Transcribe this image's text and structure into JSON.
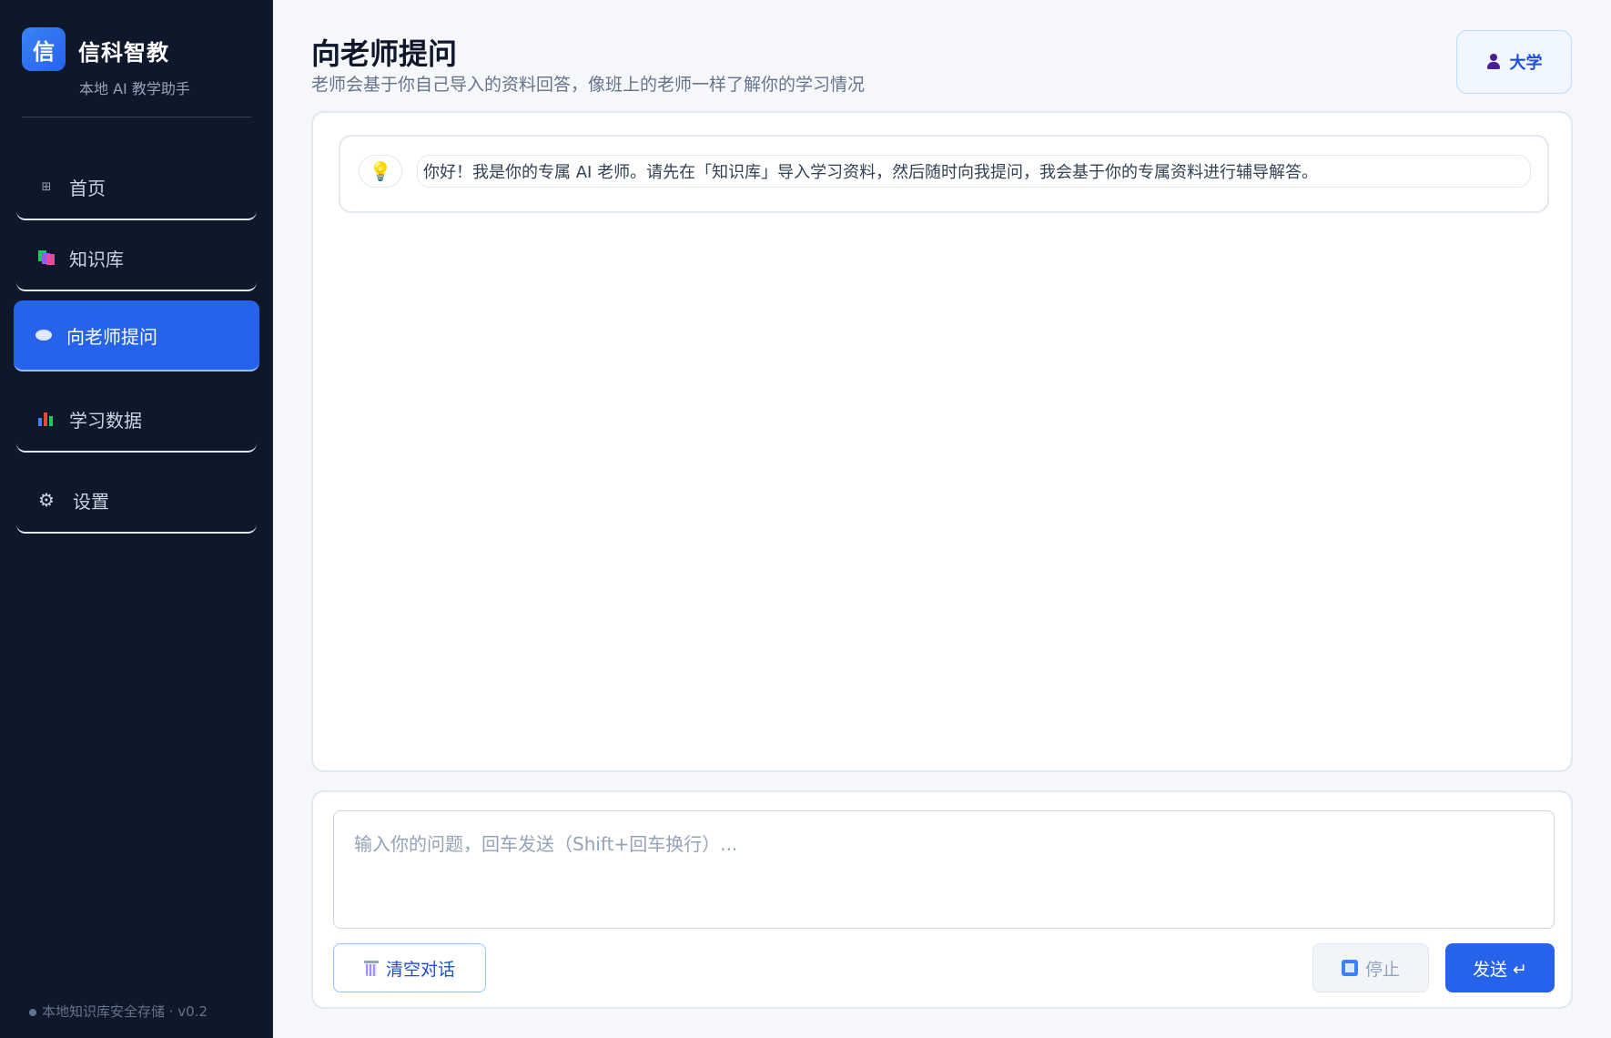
{
  "app": {
    "logo_char": "信",
    "name": "信科智教",
    "tagline": "本地 AI 教学助手"
  },
  "sidebar": {
    "items": [
      {
        "label": "首页",
        "icon": "home-grid-icon",
        "active": false
      },
      {
        "label": "知识库",
        "icon": "books-icon",
        "active": false
      },
      {
        "label": "向老师提问",
        "icon": "speech-bubble-icon",
        "active": true
      },
      {
        "label": "学习数据",
        "icon": "bar-chart-icon",
        "active": false
      },
      {
        "label": "设置",
        "icon": "gear-icon",
        "active": false
      }
    ],
    "footer": "本地知识库安全存储 · v0.2"
  },
  "header": {
    "title": "向老师提问",
    "subtitle": "老师会基于你自己导入的资料回答，像班上的老师一样了解你的学习情况",
    "level_badge": "大学"
  },
  "chat": {
    "messages": [
      {
        "role": "assistant",
        "avatar": "lightbulb-icon",
        "text": "你好！我是你的专属 AI 老师。请先在「知识库」导入学习资料，然后随时向我提问，我会基于你的专属资料进行辅导解答。"
      }
    ]
  },
  "composer": {
    "placeholder": "输入你的问题，回车发送（Shift+回车换行）...",
    "value": "",
    "clear_label": "清空对话",
    "stop_label": "停止",
    "send_label": "发送 ↵"
  },
  "colors": {
    "sidebar_bg": "#0f172a",
    "accent": "#2563eb",
    "page_bg": "#f5f7fb"
  }
}
